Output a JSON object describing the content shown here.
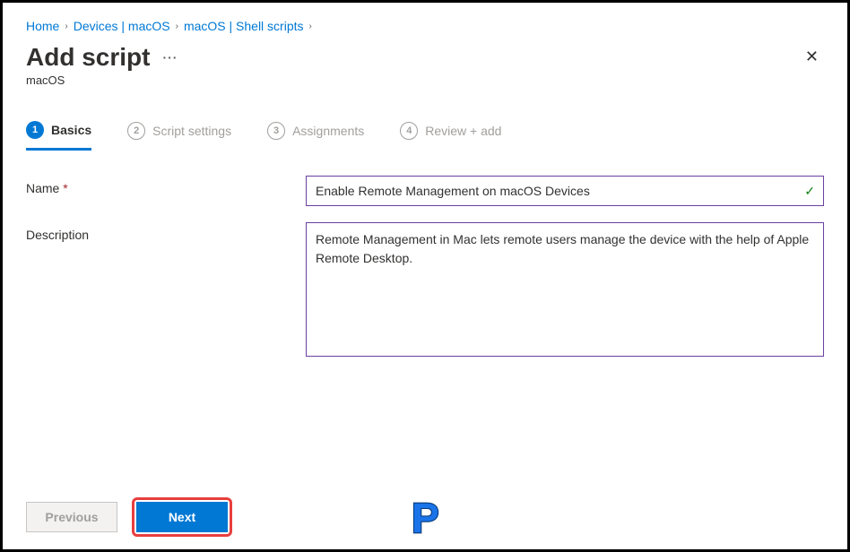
{
  "breadcrumb": {
    "items": [
      {
        "label": "Home"
      },
      {
        "label": "Devices | macOS"
      },
      {
        "label": "macOS | Shell scripts"
      }
    ]
  },
  "header": {
    "title": "Add script",
    "subtitle": "macOS"
  },
  "tabs": [
    {
      "num": "1",
      "label": "Basics"
    },
    {
      "num": "2",
      "label": "Script settings"
    },
    {
      "num": "3",
      "label": "Assignments"
    },
    {
      "num": "4",
      "label": "Review + add"
    }
  ],
  "form": {
    "name_label": "Name",
    "name_value": "Enable Remote Management on macOS Devices",
    "description_label": "Description",
    "description_value": "Remote Management in Mac lets remote users manage the device with the help of Apple Remote Desktop."
  },
  "footer": {
    "previous": "Previous",
    "next": "Next"
  }
}
